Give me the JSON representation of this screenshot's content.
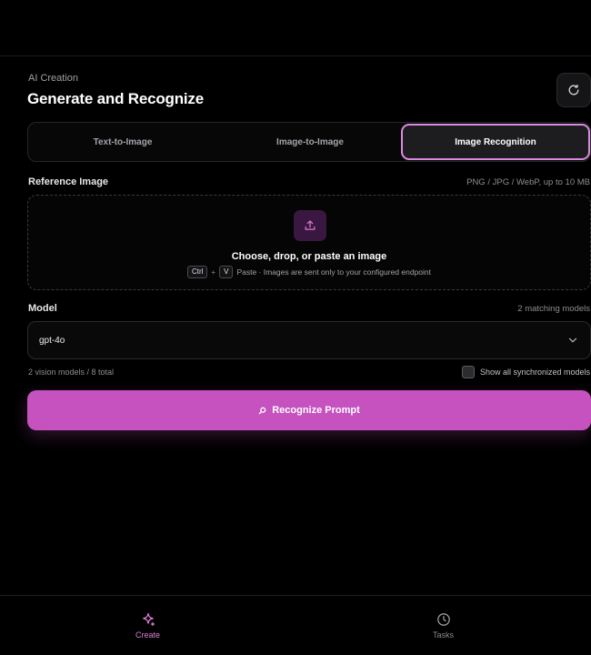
{
  "header": {
    "section": "AI Creation",
    "title": "Generate and Recognize",
    "refresh_icon": "refresh-icon"
  },
  "tabs": [
    {
      "label": "Text-to-Image",
      "active": false
    },
    {
      "label": "Image-to-Image",
      "active": false
    },
    {
      "label": "Image Recognition",
      "active": true
    }
  ],
  "reference": {
    "label": "Reference Image",
    "hint": "PNG / JPG / WebP, up to 10 MB",
    "upload_icon": "upload-icon",
    "title": "Choose, drop, or paste an image",
    "key_ctrl": "Ctrl",
    "key_plus": "+",
    "key_v": "V",
    "paste_note": "Paste · Images are sent only to your configured endpoint"
  },
  "model": {
    "label": "Model",
    "matching": "2 matching models",
    "selected": "gpt-4o",
    "vision_count": "2 vision models / 8 total",
    "show_all_label": "Show all synchronized models",
    "show_all_checked": false
  },
  "action": {
    "label": "Recognize Prompt",
    "icon": "search-icon",
    "color": "#c552bf"
  },
  "nav": [
    {
      "label": "Create",
      "icon": "sparkle-icon",
      "active": true
    },
    {
      "label": "Tasks",
      "icon": "clock-icon",
      "active": false
    }
  ],
  "colors": {
    "accent": "#c552bf",
    "accent_border": "#d98be0",
    "background": "#000000"
  }
}
